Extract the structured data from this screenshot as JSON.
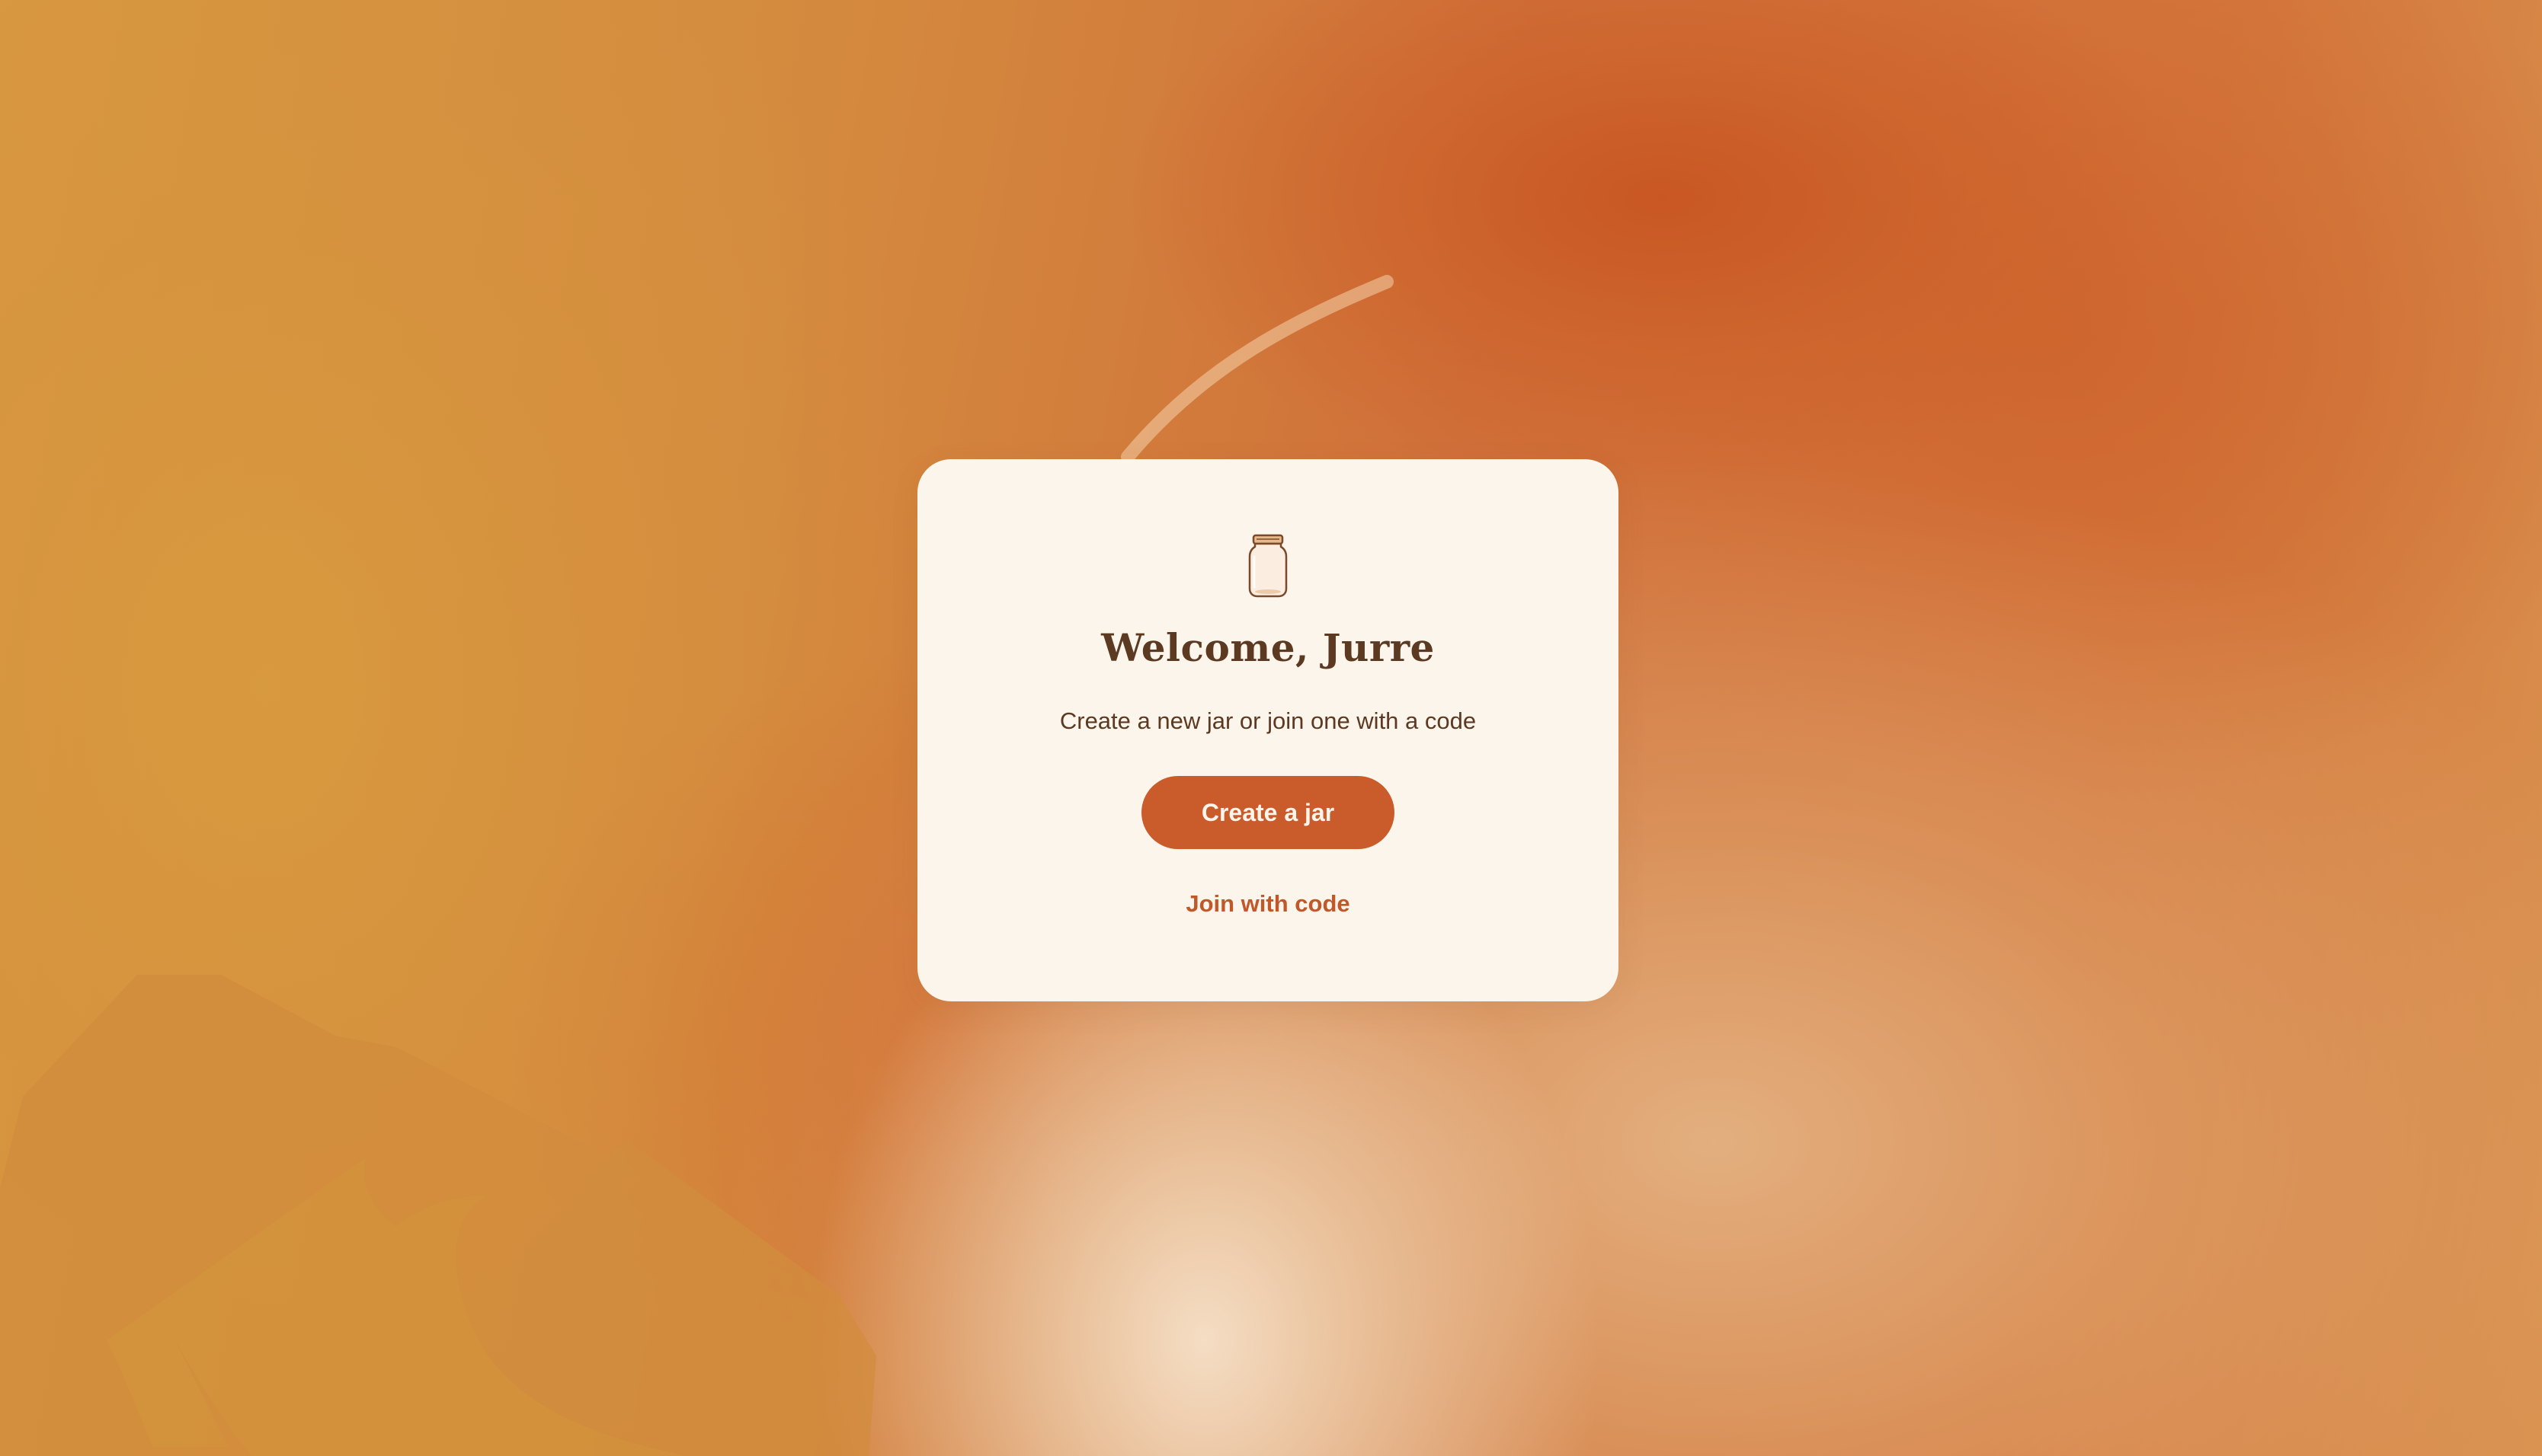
{
  "colors": {
    "card_bg": "#fcf5ec",
    "text_dark": "#5c3a22",
    "accent": "#c95c2a",
    "link": "#c0582a"
  },
  "card": {
    "icon": "jar-icon",
    "title": "Welcome, Jurre",
    "subtitle": "Create a new jar or join one with a code",
    "create_button_label": "Create a jar",
    "join_link_label": "Join with code"
  }
}
